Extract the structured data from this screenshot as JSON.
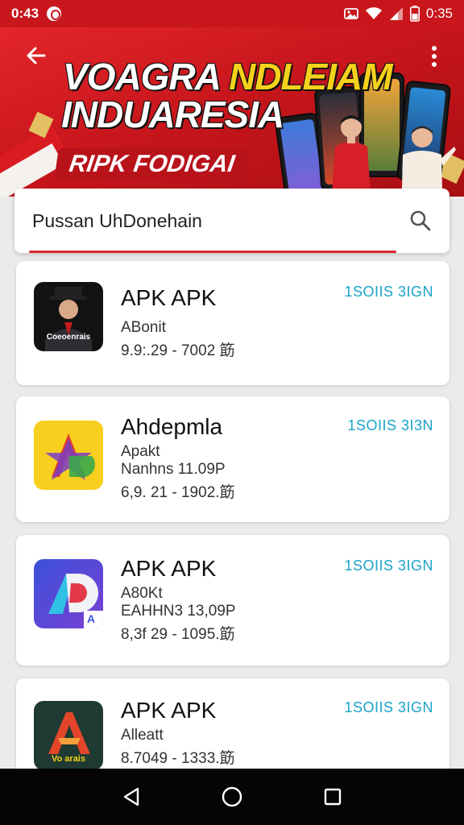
{
  "status_bar": {
    "time_left": "0:43",
    "time_right": "0:35"
  },
  "banner": {
    "title_line1_white": "VOAGRA ",
    "title_line1_yellow": "NDLEIAM",
    "title_line2": "INDUARESIA",
    "subtitle": "RIPK FODIGAI",
    "icons": [
      "back-arrow-icon",
      "more-vert-icon"
    ]
  },
  "search": {
    "value": "Pussan UhDonehain",
    "icon": "search-icon"
  },
  "apps": [
    {
      "name": "APK  APK",
      "lines": [
        "ABonit",
        "9.9:.29 - 7002 筯"
      ],
      "install_label": "1SOIIS 3IGN",
      "icon_caption": "Coeoenrais",
      "icon_style": "dark-portrait"
    },
    {
      "name": "Ahdepmla",
      "lines": [
        "Apakt",
        "Nanhns 11.09P",
        "6,9. 21 - 1902.筯"
      ],
      "install_label": "1SOIIS 3I3N",
      "icon_caption": "",
      "icon_style": "yellow-star"
    },
    {
      "name": "APK APK",
      "lines": [
        "A80Kt",
        "EAHHN3 13,09P",
        "8,3f 29 - 1095.筯"
      ],
      "install_label": "1SOIIS 3IGN",
      "icon_caption": "A",
      "icon_style": "blue-a"
    },
    {
      "name": "APK APK",
      "lines": [
        "Alleatt",
        "8.7049 - 1333.筯"
      ],
      "install_label": "1SOIIS 3IGN",
      "icon_caption": "Vo arais",
      "icon_style": "green-a"
    }
  ],
  "nav": {
    "icons": [
      "back-triangle-icon",
      "home-circle-icon",
      "recents-square-icon"
    ]
  },
  "colors": {
    "brand_red": "#c8161c",
    "accent_yellow": "#f5d11c",
    "install_blue": "#1ba3c9"
  }
}
